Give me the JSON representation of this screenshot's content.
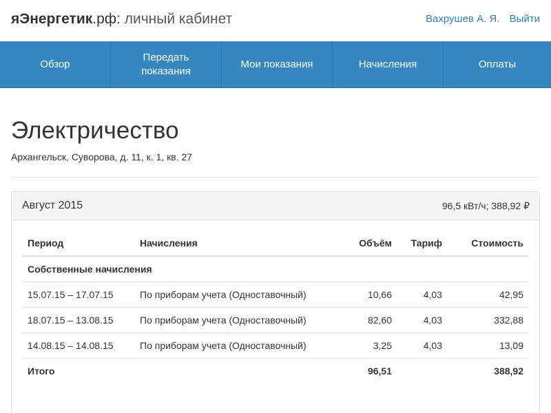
{
  "header": {
    "brand_main": "яЭнергетик",
    "brand_domain": ".рф:",
    "brand_suffix": " личный кабинет",
    "user_name": "Вахрушев А. Я.",
    "logout_label": "Выйти"
  },
  "nav": {
    "items": [
      {
        "label": "Обзор"
      },
      {
        "label": "Передать показания"
      },
      {
        "label": "Мои показания"
      },
      {
        "label": "Начисления"
      },
      {
        "label": "Оплаты"
      }
    ]
  },
  "page": {
    "title": "Электричество",
    "address": "Архангельск, Суворова, д. 11, к. 1, кв. 27"
  },
  "panel": {
    "period": "Август 2015",
    "summary": "96,5 кВт/ч; 388,92 ₽",
    "columns": [
      "Период",
      "Начисления",
      "Объём",
      "Тариф",
      "Стоимость"
    ],
    "group_label": "Собственные начисления",
    "rows": [
      {
        "period": "15.07.15 – 17.07.15",
        "charge": "По приборам учета (Одноставочный)",
        "volume": "10,66",
        "tariff": "4,03",
        "cost": "42,95"
      },
      {
        "period": "18.07.15 – 13.08.15",
        "charge": "По приборам учета (Одноставочный)",
        "volume": "82,60",
        "tariff": "4,03",
        "cost": "332,88"
      },
      {
        "period": "14.08.15 – 14.08.15",
        "charge": "По приборам учета (Одноставочный)",
        "volume": "3,25",
        "tariff": "4,03",
        "cost": "13,09"
      }
    ],
    "total": {
      "label": "Итого",
      "volume": "96,51",
      "cost": "388,92"
    }
  }
}
